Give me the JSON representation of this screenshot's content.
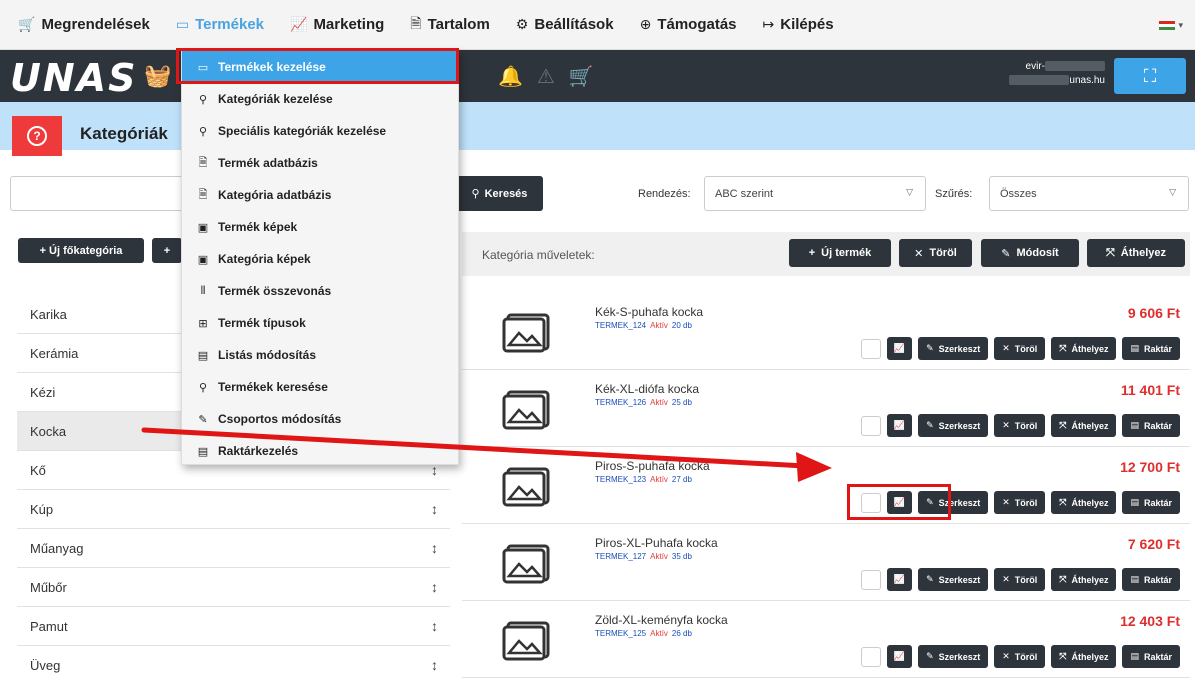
{
  "topnav": {
    "items": [
      {
        "label": "Megrendelések",
        "icon": "cart-icon",
        "glyph": "🛒"
      },
      {
        "label": "Termékek",
        "icon": "product-box-icon",
        "glyph": "▭"
      },
      {
        "label": "Marketing",
        "icon": "chart-icon",
        "glyph": "📈"
      },
      {
        "label": "Tartalom",
        "icon": "document-icon",
        "glyph": "🗎"
      },
      {
        "label": "Beállítások",
        "icon": "gear-icon",
        "glyph": "⚙"
      },
      {
        "label": "Támogatás",
        "icon": "support-icon",
        "glyph": "⊕"
      },
      {
        "label": "Kilépés",
        "icon": "logout-icon",
        "glyph": "↦"
      }
    ],
    "active": "Termékek",
    "language_flag": {
      "colors": [
        "#d52b1e",
        "#ffffff",
        "#3d8b3d"
      ]
    }
  },
  "header": {
    "logo": "UNAS",
    "user_line1": "evir-",
    "user_line2": "unas.hu"
  },
  "page_title": "Kategóriák",
  "search": {
    "value": "",
    "button_label": "Keresés"
  },
  "sort": {
    "label": "Rendezés:",
    "value": "ABC szerint"
  },
  "filter": {
    "label": "Szűrés:",
    "value": "Összes"
  },
  "left_buttons": {
    "new_main_category": "+ Új főkategória",
    "plus": "+"
  },
  "categories": [
    {
      "name": "Karika"
    },
    {
      "name": "Kerámia"
    },
    {
      "name": "Kézi"
    },
    {
      "name": "Kocka",
      "selected": true
    },
    {
      "name": "Kő"
    },
    {
      "name": "Kúp"
    },
    {
      "name": "Műanyag"
    },
    {
      "name": "Műbőr"
    },
    {
      "name": "Pamut"
    },
    {
      "name": "Üveg"
    }
  ],
  "category_ops": {
    "label": "Kategória műveletek:",
    "buttons": {
      "new_product": "Új termék",
      "delete": "Töröl",
      "modify": "Módosít",
      "move": "Áthelyez"
    }
  },
  "products": [
    {
      "name": "Kék-S-puhafa kocka",
      "sku": "TERMEK_124",
      "status": "Aktív",
      "qty": "20 db",
      "price": "9 606 Ft"
    },
    {
      "name": "Kék-XL-diófa kocka",
      "sku": "TERMEK_126",
      "status": "Aktív",
      "qty": "25 db",
      "price": "11 401 Ft"
    },
    {
      "name": "Piros-S-puhafa kocka",
      "sku": "TERMEK_123",
      "status": "Aktív",
      "qty": "27 db",
      "price": "12 700 Ft"
    },
    {
      "name": "Piros-XL-Puhafa kocka",
      "sku": "TERMEK_127",
      "status": "Aktív",
      "qty": "35 db",
      "price": "7 620 Ft"
    },
    {
      "name": "Zöld-XL-keményfa kocka",
      "sku": "TERMEK_125",
      "status": "Aktív",
      "qty": "26 db",
      "price": "12 403 Ft"
    }
  ],
  "product_actions": {
    "edit": "Szerkeszt",
    "delete": "Töröl",
    "move": "Áthelyez",
    "stock": "Raktár"
  },
  "dropdown": {
    "items": [
      {
        "label": "Termékek kezelése",
        "icon": "product-box-icon",
        "glyph": "▭",
        "active": true
      },
      {
        "label": "Kategóriák kezelése",
        "icon": "hierarchy-icon",
        "glyph": "⚲"
      },
      {
        "label": "Speciális kategóriák kezelése",
        "icon": "hierarchy-icon",
        "glyph": "⚲"
      },
      {
        "label": "Termék adatbázis",
        "icon": "file-icon",
        "glyph": "🗎"
      },
      {
        "label": "Kategória adatbázis",
        "icon": "file-icon",
        "glyph": "🗎"
      },
      {
        "label": "Termék képek",
        "icon": "image-icon",
        "glyph": "▣"
      },
      {
        "label": "Kategória képek",
        "icon": "images-icon",
        "glyph": "▣"
      },
      {
        "label": "Termék összevonás",
        "icon": "merge-icon",
        "glyph": "⫴"
      },
      {
        "label": "Termék típusok",
        "icon": "sitemap-icon",
        "glyph": "⊞"
      },
      {
        "label": "Listás módosítás",
        "icon": "clipboard-icon",
        "glyph": "▤"
      },
      {
        "label": "Termékek keresése",
        "icon": "search-icon",
        "glyph": "⚲"
      },
      {
        "label": "Csoportos módosítás",
        "icon": "edit-icon",
        "glyph": "✎"
      },
      {
        "label": "Raktárkezelés",
        "icon": "clipboard-icon",
        "glyph": "▤"
      }
    ]
  },
  "colors": {
    "accent": "#3da4e8",
    "dark": "#2e343b",
    "price": "#e02d2d",
    "annotation": "#e01515"
  }
}
